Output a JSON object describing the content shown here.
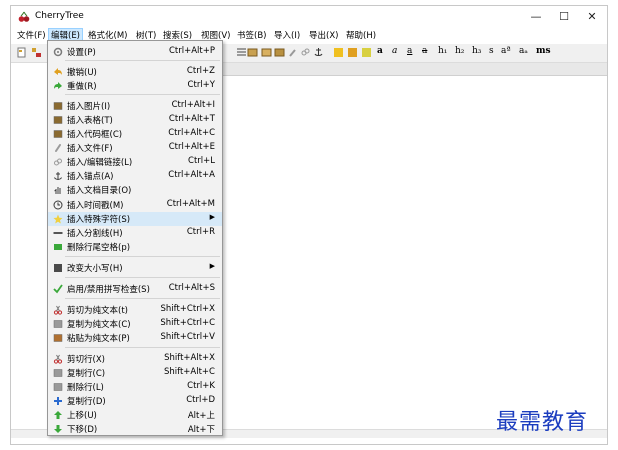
{
  "window": {
    "title": "CherryTree",
    "controls": {
      "minimize": "—",
      "maximize": "☐",
      "close": "✕"
    }
  },
  "menubar": [
    "文件(F)",
    "编辑(E)",
    "格式化(M)",
    "树(T)",
    "搜索(S)",
    "视图(V)",
    "书签(B)",
    "导入(I)",
    "导出(X)",
    "帮助(H)"
  ],
  "toolbar": {
    "text_buttons": [
      "a",
      "a",
      "a",
      "a",
      "h₁",
      "h₂",
      "h₃",
      "s",
      "aª",
      "aₐ",
      "ms"
    ]
  },
  "menu": {
    "items": [
      {
        "label": "设置(P)",
        "shortcut": "Ctrl+Alt+P",
        "icon": "settings-icon",
        "color": "#7a7a7a"
      },
      {
        "label": "撤销(U)",
        "shortcut": "Ctrl+Z",
        "icon": "undo-icon",
        "color": "#e0a020"
      },
      {
        "label": "重做(R)",
        "shortcut": "Ctrl+Y",
        "icon": "redo-icon",
        "color": "#3aa83a"
      },
      {
        "label": "插入图片(I)",
        "shortcut": "Ctrl+Alt+I",
        "icon": "image-icon",
        "color": "#8a6a30"
      },
      {
        "label": "插入表格(T)",
        "shortcut": "Ctrl+Alt+T",
        "icon": "table-icon",
        "color": "#8a6a30"
      },
      {
        "label": "插入代码框(C)",
        "shortcut": "Ctrl+Alt+C",
        "icon": "codebox-icon",
        "color": "#8a6a30"
      },
      {
        "label": "插入文件(F)",
        "shortcut": "Ctrl+Alt+E",
        "icon": "paperclip-icon",
        "color": "#9a9a9a"
      },
      {
        "label": "插入/编辑链接(L)",
        "shortcut": "Ctrl+L",
        "icon": "link-icon",
        "color": "#9a9a9a"
      },
      {
        "label": "插入锚点(A)",
        "shortcut": "Ctrl+Alt+A",
        "icon": "anchor-icon",
        "color": "#3a3a3a"
      },
      {
        "label": "插入文档目录(O)",
        "shortcut": "",
        "icon": "toc-hand-icon",
        "color": "#3a3a3a"
      },
      {
        "label": "插入时间戳(M)",
        "shortcut": "Ctrl+Alt+M",
        "icon": "clock-icon",
        "color": "#3a3a3a"
      },
      {
        "label": "插入特殊字符(S)",
        "shortcut": "",
        "icon": "star-icon",
        "color": "#f0d040",
        "submenu": true
      },
      {
        "label": "插入分割线(H)",
        "shortcut": "Ctrl+R",
        "icon": "hr-icon",
        "color": "#555555"
      },
      {
        "label": "删除行尾空格(p)",
        "shortcut": "",
        "icon": "strip-spaces-icon",
        "color": "#3aa83a"
      },
      {
        "label": "改变大小写(H)",
        "shortcut": "",
        "icon": "case-icon",
        "color": "#4a4a4a",
        "submenu": true
      },
      {
        "label": "启用/禁用拼写检查(S)",
        "shortcut": "Ctrl+Alt+S",
        "icon": "spellcheck-icon",
        "color": "#3aa83a"
      },
      {
        "label": "剪切为纯文本(t)",
        "shortcut": "Shift+Ctrl+X",
        "icon": "cut-icon",
        "color": "#c03030"
      },
      {
        "label": "复制为纯文本(C)",
        "shortcut": "Shift+Ctrl+C",
        "icon": "copy-icon",
        "color": "#9a9a9a"
      },
      {
        "label": "粘贴为纯文本(P)",
        "shortcut": "Shift+Ctrl+V",
        "icon": "paste-icon",
        "color": "#b07030"
      },
      {
        "label": "剪切行(X)",
        "shortcut": "Shift+Alt+X",
        "icon": "cut-row-icon",
        "color": "#c03030"
      },
      {
        "label": "复制行(C)",
        "shortcut": "Shift+Alt+C",
        "icon": "copy-row-icon",
        "color": "#9a9a9a"
      },
      {
        "label": "删除行(L)",
        "shortcut": "Ctrl+K",
        "icon": "delete-row-icon",
        "color": "#9a9a9a"
      },
      {
        "label": "复制行(D)",
        "shortcut": "Ctrl+D",
        "icon": "duplicate-plus-icon",
        "color": "#2a6ad0"
      },
      {
        "label": "上移(U)",
        "shortcut": "Alt+上",
        "icon": "arrow-up-icon",
        "color": "#3aa83a"
      },
      {
        "label": "下移(D)",
        "shortcut": "Alt+下",
        "icon": "arrow-down-icon",
        "color": "#3aa83a"
      }
    ]
  },
  "watermark": "最需教育"
}
